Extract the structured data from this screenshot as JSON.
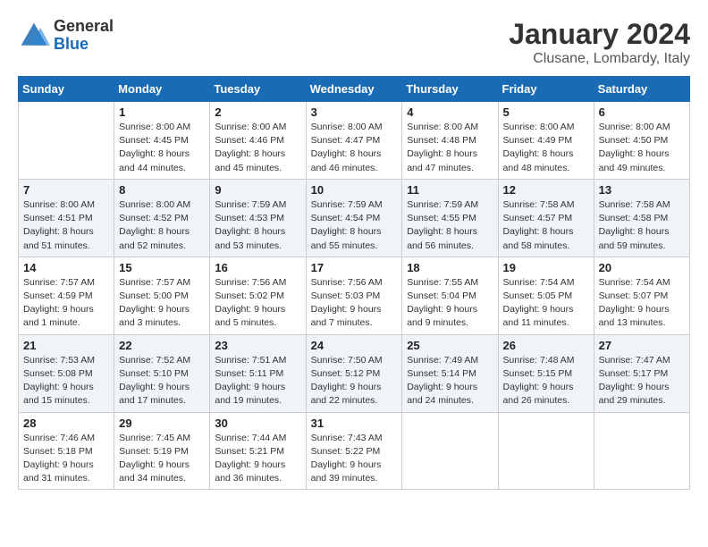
{
  "header": {
    "logo_general": "General",
    "logo_blue": "Blue",
    "month": "January 2024",
    "location": "Clusane, Lombardy, Italy"
  },
  "days_of_week": [
    "Sunday",
    "Monday",
    "Tuesday",
    "Wednesday",
    "Thursday",
    "Friday",
    "Saturday"
  ],
  "weeks": [
    [
      {
        "day": "",
        "info": ""
      },
      {
        "day": "1",
        "info": "Sunrise: 8:00 AM\nSunset: 4:45 PM\nDaylight: 8 hours\nand 44 minutes."
      },
      {
        "day": "2",
        "info": "Sunrise: 8:00 AM\nSunset: 4:46 PM\nDaylight: 8 hours\nand 45 minutes."
      },
      {
        "day": "3",
        "info": "Sunrise: 8:00 AM\nSunset: 4:47 PM\nDaylight: 8 hours\nand 46 minutes."
      },
      {
        "day": "4",
        "info": "Sunrise: 8:00 AM\nSunset: 4:48 PM\nDaylight: 8 hours\nand 47 minutes."
      },
      {
        "day": "5",
        "info": "Sunrise: 8:00 AM\nSunset: 4:49 PM\nDaylight: 8 hours\nand 48 minutes."
      },
      {
        "day": "6",
        "info": "Sunrise: 8:00 AM\nSunset: 4:50 PM\nDaylight: 8 hours\nand 49 minutes."
      }
    ],
    [
      {
        "day": "7",
        "info": "Sunrise: 8:00 AM\nSunset: 4:51 PM\nDaylight: 8 hours\nand 51 minutes."
      },
      {
        "day": "8",
        "info": "Sunrise: 8:00 AM\nSunset: 4:52 PM\nDaylight: 8 hours\nand 52 minutes."
      },
      {
        "day": "9",
        "info": "Sunrise: 7:59 AM\nSunset: 4:53 PM\nDaylight: 8 hours\nand 53 minutes."
      },
      {
        "day": "10",
        "info": "Sunrise: 7:59 AM\nSunset: 4:54 PM\nDaylight: 8 hours\nand 55 minutes."
      },
      {
        "day": "11",
        "info": "Sunrise: 7:59 AM\nSunset: 4:55 PM\nDaylight: 8 hours\nand 56 minutes."
      },
      {
        "day": "12",
        "info": "Sunrise: 7:58 AM\nSunset: 4:57 PM\nDaylight: 8 hours\nand 58 minutes."
      },
      {
        "day": "13",
        "info": "Sunrise: 7:58 AM\nSunset: 4:58 PM\nDaylight: 8 hours\nand 59 minutes."
      }
    ],
    [
      {
        "day": "14",
        "info": "Sunrise: 7:57 AM\nSunset: 4:59 PM\nDaylight: 9 hours\nand 1 minute."
      },
      {
        "day": "15",
        "info": "Sunrise: 7:57 AM\nSunset: 5:00 PM\nDaylight: 9 hours\nand 3 minutes."
      },
      {
        "day": "16",
        "info": "Sunrise: 7:56 AM\nSunset: 5:02 PM\nDaylight: 9 hours\nand 5 minutes."
      },
      {
        "day": "17",
        "info": "Sunrise: 7:56 AM\nSunset: 5:03 PM\nDaylight: 9 hours\nand 7 minutes."
      },
      {
        "day": "18",
        "info": "Sunrise: 7:55 AM\nSunset: 5:04 PM\nDaylight: 9 hours\nand 9 minutes."
      },
      {
        "day": "19",
        "info": "Sunrise: 7:54 AM\nSunset: 5:05 PM\nDaylight: 9 hours\nand 11 minutes."
      },
      {
        "day": "20",
        "info": "Sunrise: 7:54 AM\nSunset: 5:07 PM\nDaylight: 9 hours\nand 13 minutes."
      }
    ],
    [
      {
        "day": "21",
        "info": "Sunrise: 7:53 AM\nSunset: 5:08 PM\nDaylight: 9 hours\nand 15 minutes."
      },
      {
        "day": "22",
        "info": "Sunrise: 7:52 AM\nSunset: 5:10 PM\nDaylight: 9 hours\nand 17 minutes."
      },
      {
        "day": "23",
        "info": "Sunrise: 7:51 AM\nSunset: 5:11 PM\nDaylight: 9 hours\nand 19 minutes."
      },
      {
        "day": "24",
        "info": "Sunrise: 7:50 AM\nSunset: 5:12 PM\nDaylight: 9 hours\nand 22 minutes."
      },
      {
        "day": "25",
        "info": "Sunrise: 7:49 AM\nSunset: 5:14 PM\nDaylight: 9 hours\nand 24 minutes."
      },
      {
        "day": "26",
        "info": "Sunrise: 7:48 AM\nSunset: 5:15 PM\nDaylight: 9 hours\nand 26 minutes."
      },
      {
        "day": "27",
        "info": "Sunrise: 7:47 AM\nSunset: 5:17 PM\nDaylight: 9 hours\nand 29 minutes."
      }
    ],
    [
      {
        "day": "28",
        "info": "Sunrise: 7:46 AM\nSunset: 5:18 PM\nDaylight: 9 hours\nand 31 minutes."
      },
      {
        "day": "29",
        "info": "Sunrise: 7:45 AM\nSunset: 5:19 PM\nDaylight: 9 hours\nand 34 minutes."
      },
      {
        "day": "30",
        "info": "Sunrise: 7:44 AM\nSunset: 5:21 PM\nDaylight: 9 hours\nand 36 minutes."
      },
      {
        "day": "31",
        "info": "Sunrise: 7:43 AM\nSunset: 5:22 PM\nDaylight: 9 hours\nand 39 minutes."
      },
      {
        "day": "",
        "info": ""
      },
      {
        "day": "",
        "info": ""
      },
      {
        "day": "",
        "info": ""
      }
    ]
  ]
}
